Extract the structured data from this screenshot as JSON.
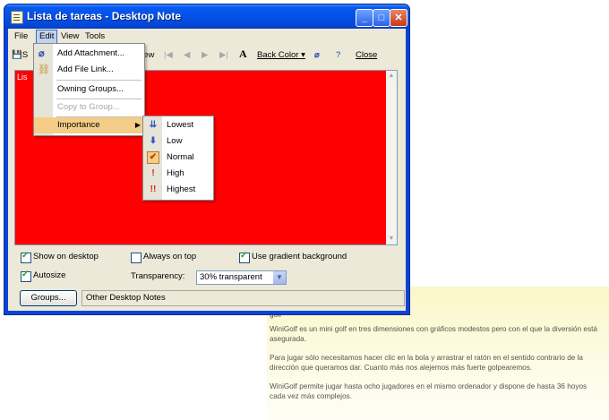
{
  "window": {
    "title": "Lista de tareas - Desktop Note"
  },
  "menubar": {
    "items": [
      "File",
      "Edit",
      "View",
      "Tools"
    ]
  },
  "toolbar": {
    "save_fragment": "S",
    "view_label": "View",
    "font_glyph": "A",
    "back_color_label": "Back Color",
    "close_label": "Close"
  },
  "note": {
    "text_fragment": "Lis"
  },
  "options": {
    "show_on_desktop": "Show on desktop",
    "always_on_top": "Always on top",
    "gradient_bg": "Use gradient background",
    "autosize": "Autosize",
    "transparency_label": "Transparency:",
    "transparency_value": "30% transparent"
  },
  "states": {
    "show_on_desktop": true,
    "always_on_top": false,
    "gradient_bg": true,
    "autosize": true
  },
  "groups": {
    "button": "Groups...",
    "field": "Other Desktop Notes"
  },
  "edit_menu": {
    "items": [
      "Add Attachment...",
      "Add File Link...",
      "Owning Groups...",
      "Copy to Group...",
      "Importance"
    ]
  },
  "importance_menu": {
    "items": [
      "Lowest",
      "Low",
      "Normal",
      "High",
      "Highest"
    ]
  },
  "background_note": {
    "title_fragment": "golf",
    "paragraphs": [
      "WiniGolf es un mini golf en tres dimensiones con gráficos modestos pero con el que la diversión está asegurada.",
      "Para jugar sólo necesitamos hacer clic en la bola y arrastrar el ratón en el sentido contrario de la dirección que queramos dar. Cuanto más nos alejemos más fuerte golpearemos.",
      "WiniGolf permite jugar hasta ocho jugadores en el mismo ordenador y dispone de hasta 36 hoyos cada vez más complejos."
    ]
  },
  "colors": {
    "note_background": "#ff0000",
    "title_bar": "#0551e6",
    "menu_highlight": "#f4cd88",
    "yellow_note": "#fdfbe6"
  },
  "icons": [
    "app-note-icon",
    "minimize-icon",
    "maximize-icon",
    "close-icon",
    "save-icon",
    "paperclip-icon",
    "help-icon",
    "file-link-icon",
    "importance-arrow-icons"
  ]
}
